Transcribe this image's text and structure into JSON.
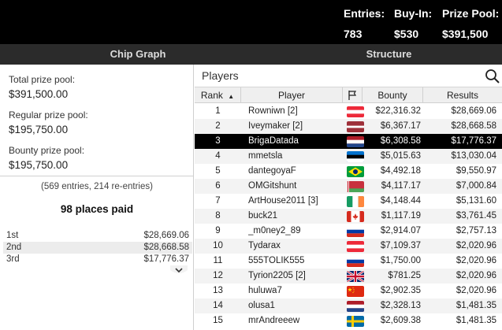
{
  "header": {
    "stats": [
      {
        "label": "Entries:",
        "value": "783"
      },
      {
        "label": "Buy-In:",
        "value": "$530"
      },
      {
        "label": "Prize Pool:",
        "value": "$391,500"
      }
    ]
  },
  "tabs": {
    "chip_graph": "Chip Graph",
    "structure": "Structure"
  },
  "prize_info": {
    "total_label": "Total prize pool:",
    "total_value": "$391,500.00",
    "regular_label": "Regular prize pool:",
    "regular_value": "$195,750.00",
    "bounty_label": "Bounty prize pool:",
    "bounty_value": "$195,750.00",
    "entries_note": "(569 entries, 214 re-entries)",
    "places_paid": "98 places paid",
    "payouts": [
      {
        "place": "1st",
        "amount": "$28,669.06"
      },
      {
        "place": "2nd",
        "amount": "$28,668.58"
      },
      {
        "place": "3rd",
        "amount": "$17,776.37"
      }
    ]
  },
  "players": {
    "title": "Players",
    "columns": {
      "rank": "Rank",
      "sort_indicator": "▲",
      "player": "Player",
      "bounty": "Bounty",
      "results": "Results"
    },
    "selected_rank": "3",
    "rows": [
      {
        "rank": "1",
        "player": "Rowniwn [2]",
        "flag": "austria",
        "bounty": "$22,316.32",
        "results": "$28,669.06"
      },
      {
        "rank": "2",
        "player": "Iveymaker [2]",
        "flag": "latvia",
        "bounty": "$6,367.17",
        "results": "$28,668.58"
      },
      {
        "rank": "3",
        "player": "BrigaDatada",
        "flag": "netherlands",
        "bounty": "$6,308.58",
        "results": "$17,776.37"
      },
      {
        "rank": "4",
        "player": "mmetsla",
        "flag": "estonia",
        "bounty": "$5,015.63",
        "results": "$13,030.04"
      },
      {
        "rank": "5",
        "player": "dantegoyaF",
        "flag": "brazil",
        "bounty": "$4,492.18",
        "results": "$9,550.97"
      },
      {
        "rank": "6",
        "player": "OMGitshunt",
        "flag": "belarus",
        "bounty": "$4,117.17",
        "results": "$7,000.84"
      },
      {
        "rank": "7",
        "player": "ArtHouse2011 [3]",
        "flag": "ireland",
        "bounty": "$4,148.44",
        "results": "$5,131.60"
      },
      {
        "rank": "8",
        "player": "buck21",
        "flag": "canada",
        "bounty": "$1,117.19",
        "results": "$3,761.45"
      },
      {
        "rank": "9",
        "player": "_m0ney2_89",
        "flag": "russia",
        "bounty": "$2,914.07",
        "results": "$2,757.13"
      },
      {
        "rank": "10",
        "player": "Tydarax",
        "flag": "austria",
        "bounty": "$7,109.37",
        "results": "$2,020.96"
      },
      {
        "rank": "11",
        "player": "555TOLIK555",
        "flag": "russia",
        "bounty": "$1,750.00",
        "results": "$2,020.96"
      },
      {
        "rank": "12",
        "player": "Tyrion2205 [2]",
        "flag": "uk",
        "bounty": "$781.25",
        "results": "$2,020.96"
      },
      {
        "rank": "13",
        "player": "huluwa7",
        "flag": "china",
        "bounty": "$2,902.35",
        "results": "$2,020.96"
      },
      {
        "rank": "14",
        "player": "olusa1",
        "flag": "netherlands",
        "bounty": "$2,328.13",
        "results": "$1,481.35"
      },
      {
        "rank": "15",
        "player": "mrAndreeew",
        "flag": "sweden",
        "bounty": "$2,609.38",
        "results": "$1,481.35"
      }
    ]
  }
}
